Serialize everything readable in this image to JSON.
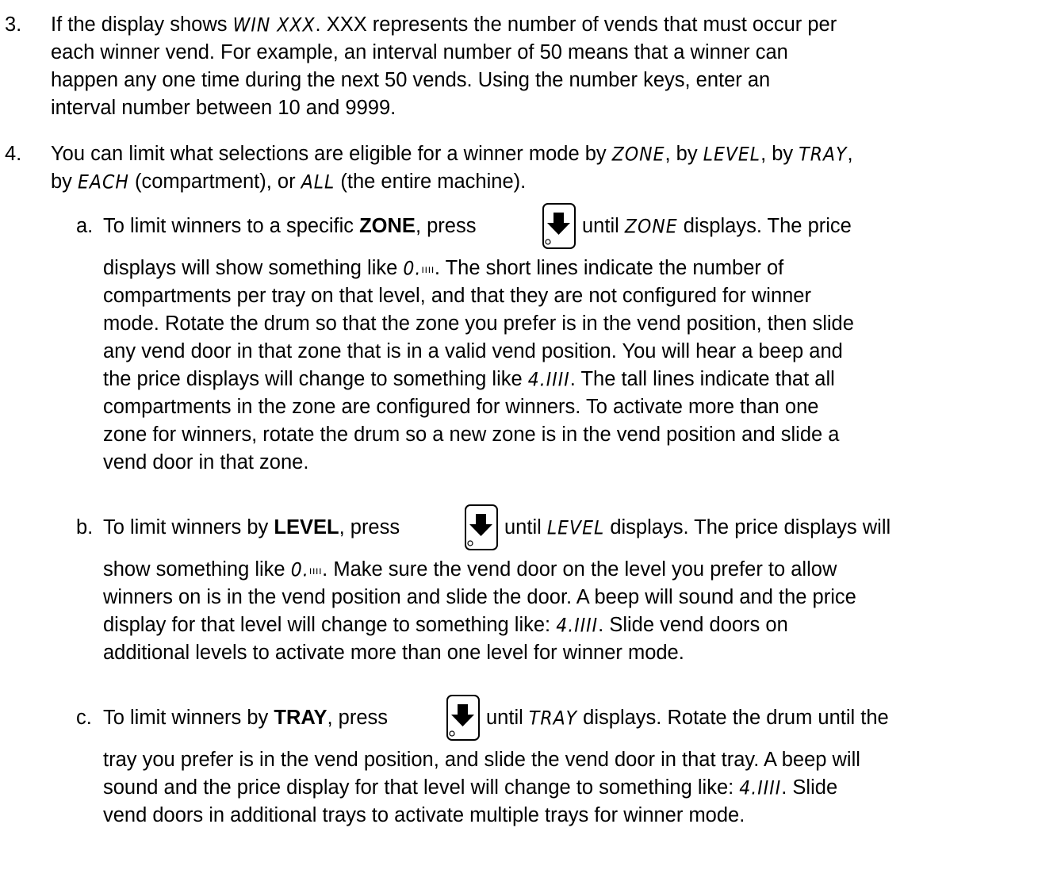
{
  "items": [
    {
      "number": "3.",
      "lines": [
        [
          "If the display shows ",
          {
            "disp": "WIN   XXX"
          },
          ".  XXX represents the number of vends that must occur per"
        ],
        [
          "each winner vend.  For example, an interval number of 50 means that a winner can"
        ],
        [
          "happen any one time during the next 50 vends.  Using the number keys, enter an"
        ],
        [
          "interval number between 10 and 9999."
        ]
      ]
    },
    {
      "number": "4.",
      "lines": [
        [
          "You can limit what selections are eligible for a winner mode by ",
          {
            "disp": "ZONE"
          },
          ", by ",
          {
            "disp": "LEVEL"
          },
          ", by ",
          {
            "disp": "TRAY"
          },
          ","
        ],
        [
          "by ",
          {
            "disp": "EACH"
          },
          " (compartment), or ",
          {
            "disp": "ALL"
          },
          " (the entire machine)."
        ]
      ]
    }
  ],
  "subitems": [
    {
      "letter": "a.",
      "first_before": "To limit winners to a specific ",
      "first_bold": "ZONE",
      "first_after": ", press",
      "first_tail": [
        " until ",
        {
          "disp": "ZONE"
        },
        " displays. The price"
      ],
      "lines": [
        [
          "displays will show something like ",
          {
            "disp": "0."
          },
          {
            "ticks": "ıııı"
          },
          ". The short lines indicate the number of"
        ],
        [
          "compartments per tray on that level, and that they are not configured for winner"
        ],
        [
          "mode. Rotate the drum so that the zone you prefer is in the vend position, then slide"
        ],
        [
          "any vend door in that zone that is in a valid vend position. You will hear a beep and"
        ],
        [
          "the price displays will change to something like ",
          {
            "disp": "4.IIII"
          },
          ". The tall lines indicate that all"
        ],
        [
          "compartments in the zone are configured for winners. To activate more than one"
        ],
        [
          "zone for winners, rotate the drum so a new zone is in the vend position and slide a"
        ],
        [
          "vend door in that zone."
        ]
      ]
    },
    {
      "letter": "b.",
      "first_before": "To limit winners by ",
      "first_bold": "LEVEL",
      "first_after": ", press",
      "first_tail": [
        " until ",
        {
          "disp": "LEVEL"
        },
        " displays. The price displays will"
      ],
      "lines": [
        [
          "show something like ",
          {
            "disp": "0."
          },
          {
            "ticks": "ıııı"
          },
          ". Make sure the vend door on the level you prefer to allow"
        ],
        [
          "winners on is in the vend position and slide the door. A beep will sound and the price"
        ],
        [
          "display for that level will change to something like: ",
          {
            "disp": "4.IIII"
          },
          ". Slide vend doors on"
        ],
        [
          "additional levels to activate more than one level for winner mode."
        ]
      ]
    },
    {
      "letter": "c.",
      "first_before": "To limit winners by ",
      "first_bold": "TRAY",
      "first_after": ", press",
      "first_tail": [
        " until ",
        {
          "disp": "TRAY"
        },
        " displays. Rotate the drum until the"
      ],
      "lines": [
        [
          "tray you prefer is in the vend position, and slide the vend door in that tray. A beep will"
        ],
        [
          "sound and the price display for that level will change to something like: ",
          {
            "disp": "4.IIII"
          },
          ". Slide"
        ],
        [
          "vend doors in additional trays to activate multiple trays for winner mode."
        ]
      ]
    }
  ],
  "icons": {
    "key": "down-arrow-key-icon"
  }
}
